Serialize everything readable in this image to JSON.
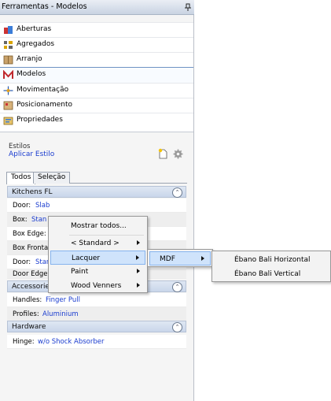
{
  "window": {
    "title": "Ferramentas - Modelos",
    "pin_icon": "pin-icon"
  },
  "nav": {
    "items": [
      {
        "label": "Aberturas",
        "icon": "aberturas-icon"
      },
      {
        "label": "Agregados",
        "icon": "agregados-icon"
      },
      {
        "label": "Arranjo",
        "icon": "arranjo-icon"
      },
      {
        "label": "Modelos",
        "icon": "modelos-icon",
        "selected": true
      },
      {
        "label": "Movimentação",
        "icon": "movimentacao-icon"
      },
      {
        "label": "Posicionamento",
        "icon": "posicionamento-icon"
      },
      {
        "label": "Propriedades",
        "icon": "propriedades-icon"
      }
    ]
  },
  "estilos": {
    "label": "Estilos",
    "apply_link": "Aplicar Estilo"
  },
  "tabs": [
    {
      "label": "Todos",
      "active": true
    },
    {
      "label": "Seleção"
    }
  ],
  "groups": {
    "kitchens": {
      "title": "Kitchens FL",
      "rows": [
        {
          "key": "Door:",
          "value": "Slab"
        },
        {
          "key": "Box:",
          "value": "Stan"
        },
        {
          "key": "Box Edge:",
          "value": ""
        },
        {
          "key": "Box Fronta",
          "value": ""
        },
        {
          "key": "Door:",
          "value": "Star"
        },
        {
          "key": "Door Edge:",
          "value": ""
        }
      ]
    },
    "accessories": {
      "title": "Accessorie",
      "rows": [
        {
          "key": "Handles:",
          "value": "Finger Pull"
        },
        {
          "key": "Profiles:",
          "value": "Aluminium"
        }
      ]
    },
    "hardware": {
      "title": "Hardware",
      "rows": [
        {
          "key": "Hinge:",
          "value": "w/o Shock Absorber"
        }
      ]
    }
  },
  "context_menu": {
    "items": [
      {
        "label": "Mostrar todos...",
        "submenu": false
      },
      {
        "label": "< Standard >",
        "submenu": true
      },
      {
        "label": "Lacquer",
        "submenu": true,
        "highlighted": true
      },
      {
        "label": "Paint",
        "submenu": true
      },
      {
        "label": "Wood Venners",
        "submenu": true
      }
    ]
  },
  "submenu_1": {
    "items": [
      {
        "label": "MDF",
        "submenu": true,
        "highlighted": true
      }
    ]
  },
  "submenu_2": {
    "items": [
      {
        "label": "Ébano Bali Horizontal"
      },
      {
        "label": "Ébano Bali Vertical"
      }
    ]
  },
  "colors": {
    "link": "#1a3ccf",
    "highlight": "#cfe3fb",
    "group_header": "#d3deee"
  }
}
